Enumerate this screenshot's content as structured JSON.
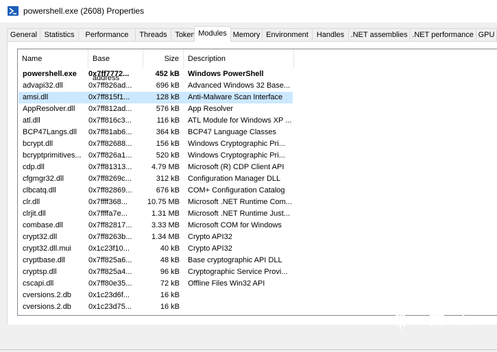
{
  "window": {
    "title": "powershell.exe (2608) Properties",
    "icon": "powershell-icon"
  },
  "tabs": [
    {
      "label": "General"
    },
    {
      "label": "Statistics"
    },
    {
      "label": "Performance"
    },
    {
      "label": "Threads"
    },
    {
      "label": "Token"
    },
    {
      "label": "Modules",
      "active": true
    },
    {
      "label": "Memory"
    },
    {
      "label": "Environment"
    },
    {
      "label": "Handles"
    },
    {
      "label": ".NET assemblies"
    },
    {
      "label": ".NET performance"
    },
    {
      "label": "GPU"
    }
  ],
  "columns": [
    "Name",
    "Base address",
    "Size",
    "Description"
  ],
  "rows": [
    {
      "name": "powershell.exe",
      "base": "0x7ff7772...",
      "size": "452 kB",
      "desc": "Windows PowerShell",
      "bold": true
    },
    {
      "name": "advapi32.dll",
      "base": "0x7ff826ad...",
      "size": "696 kB",
      "desc": "Advanced Windows 32 Base..."
    },
    {
      "name": "amsi.dll",
      "base": "0x7ff815f1...",
      "size": "128 kB",
      "desc": "Anti-Malware Scan Interface",
      "selected": true
    },
    {
      "name": "AppResolver.dll",
      "base": "0x7ff812ad...",
      "size": "576 kB",
      "desc": "App Resolver"
    },
    {
      "name": "atl.dll",
      "base": "0x7ff816c3...",
      "size": "116 kB",
      "desc": "ATL Module for Windows XP ..."
    },
    {
      "name": "BCP47Langs.dll",
      "base": "0x7ff81ab6...",
      "size": "364 kB",
      "desc": "BCP47 Language Classes"
    },
    {
      "name": "bcrypt.dll",
      "base": "0x7ff82688...",
      "size": "156 kB",
      "desc": "Windows Cryptographic Pri..."
    },
    {
      "name": "bcryptprimitives...",
      "base": "0x7ff826a1...",
      "size": "520 kB",
      "desc": "Windows Cryptographic Pri..."
    },
    {
      "name": "cdp.dll",
      "base": "0x7ff81313...",
      "size": "4.79 MB",
      "desc": "Microsoft (R) CDP Client API"
    },
    {
      "name": "cfgmgr32.dll",
      "base": "0x7ff8269c...",
      "size": "312 kB",
      "desc": "Configuration Manager DLL"
    },
    {
      "name": "clbcatq.dll",
      "base": "0x7ff82869...",
      "size": "676 kB",
      "desc": "COM+ Configuration Catalog"
    },
    {
      "name": "clr.dll",
      "base": "0x7ffff368...",
      "size": "10.75 MB",
      "desc": "Microsoft .NET Runtime Com..."
    },
    {
      "name": "clrjit.dll",
      "base": "0x7ffffa7e...",
      "size": "1.31 MB",
      "desc": "Microsoft .NET Runtime Just..."
    },
    {
      "name": "combase.dll",
      "base": "0x7ff82817...",
      "size": "3.33 MB",
      "desc": "Microsoft COM for Windows"
    },
    {
      "name": "crypt32.dll",
      "base": "0x7ff8263b...",
      "size": "1.34 MB",
      "desc": "Crypto API32"
    },
    {
      "name": "crypt32.dll.mui",
      "base": "0x1c23f10...",
      "size": "40 kB",
      "desc": "Crypto API32"
    },
    {
      "name": "cryptbase.dll",
      "base": "0x7ff825a6...",
      "size": "48 kB",
      "desc": "Base cryptographic API DLL"
    },
    {
      "name": "cryptsp.dll",
      "base": "0x7ff825a4...",
      "size": "96 kB",
      "desc": "Cryptographic Service Provi..."
    },
    {
      "name": "cscapi.dll",
      "base": "0x7ff80e35...",
      "size": "72 kB",
      "desc": "Offline Files Win32 API"
    },
    {
      "name": "cversions.2.db",
      "base": "0x1c23d6f...",
      "size": "16 kB",
      "desc": ""
    },
    {
      "name": "cversions.2.db",
      "base": "0x1c23d75...",
      "size": "16 kB",
      "desc": ""
    }
  ],
  "watermark": {
    "text": "看雪",
    "icon": "snowflake-icon"
  },
  "colors": {
    "selection": "#cce8ff",
    "window_bg": "#f0f0f0",
    "icon_blue": "#1c5fb8"
  }
}
